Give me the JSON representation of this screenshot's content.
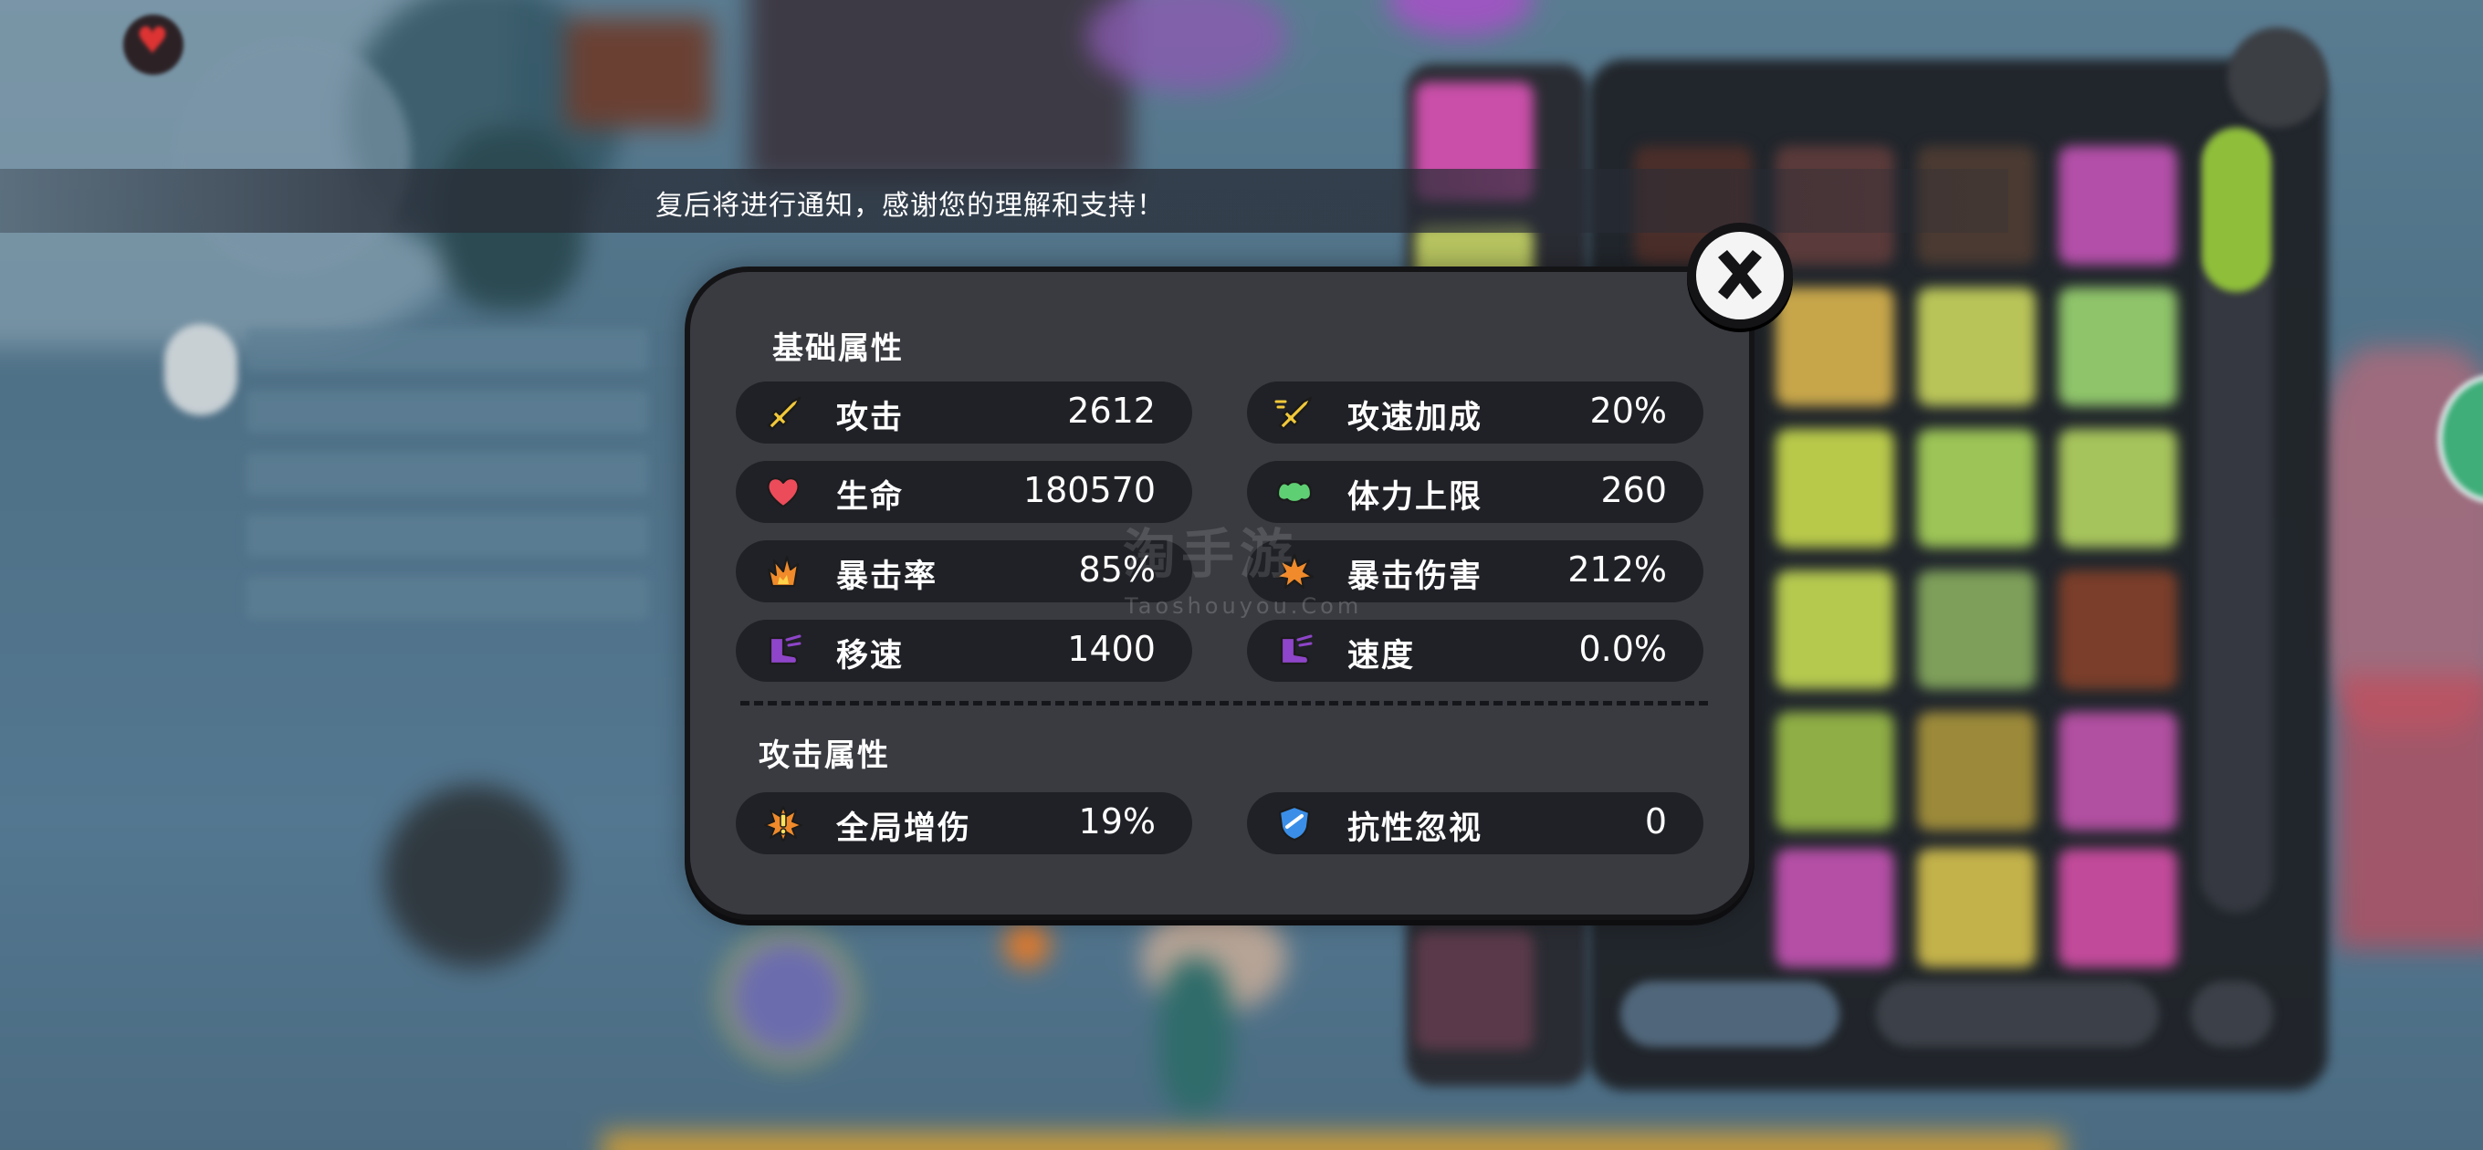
{
  "notice": {
    "text": "复后将进行通知，感谢您的理解和支持！"
  },
  "dialog": {
    "basic_section_title": "基础属性",
    "basic_stats": [
      {
        "label": "攻击",
        "value": "2612",
        "icon": "sword-icon",
        "color": "#f2c93a"
      },
      {
        "label": "攻速加成",
        "value": "20%",
        "icon": "sword-speed-icon",
        "color": "#f2c93a"
      },
      {
        "label": "生命",
        "value": "180570",
        "icon": "heart-icon",
        "color": "#ec4b5a"
      },
      {
        "label": "体力上限",
        "value": "260",
        "icon": "muscle-icon",
        "color": "#5fcf74"
      },
      {
        "label": "暴击率",
        "value": "85%",
        "icon": "crit-fire-icon",
        "color": "#f08a2a"
      },
      {
        "label": "暴击伤害",
        "value": "212%",
        "icon": "crit-burst-icon",
        "color": "#f08a2a"
      },
      {
        "label": "移速",
        "value": "1400",
        "icon": "boot-icon",
        "color": "#8e45c9"
      },
      {
        "label": "速度",
        "value": "0.0%",
        "icon": "boot-icon",
        "color": "#8e45c9"
      }
    ],
    "attack_section_title": "攻击属性",
    "attack_stats": [
      {
        "label": "全局增伤",
        "value": "19%",
        "icon": "damage-boost-icon",
        "color": "#f08a2a"
      },
      {
        "label": "抗性忽视",
        "value": "0",
        "icon": "shield-icon",
        "color": "#3a8ee8"
      }
    ]
  },
  "watermark": {
    "text": "淘手游",
    "sub": "Taoshouyou.Com"
  }
}
